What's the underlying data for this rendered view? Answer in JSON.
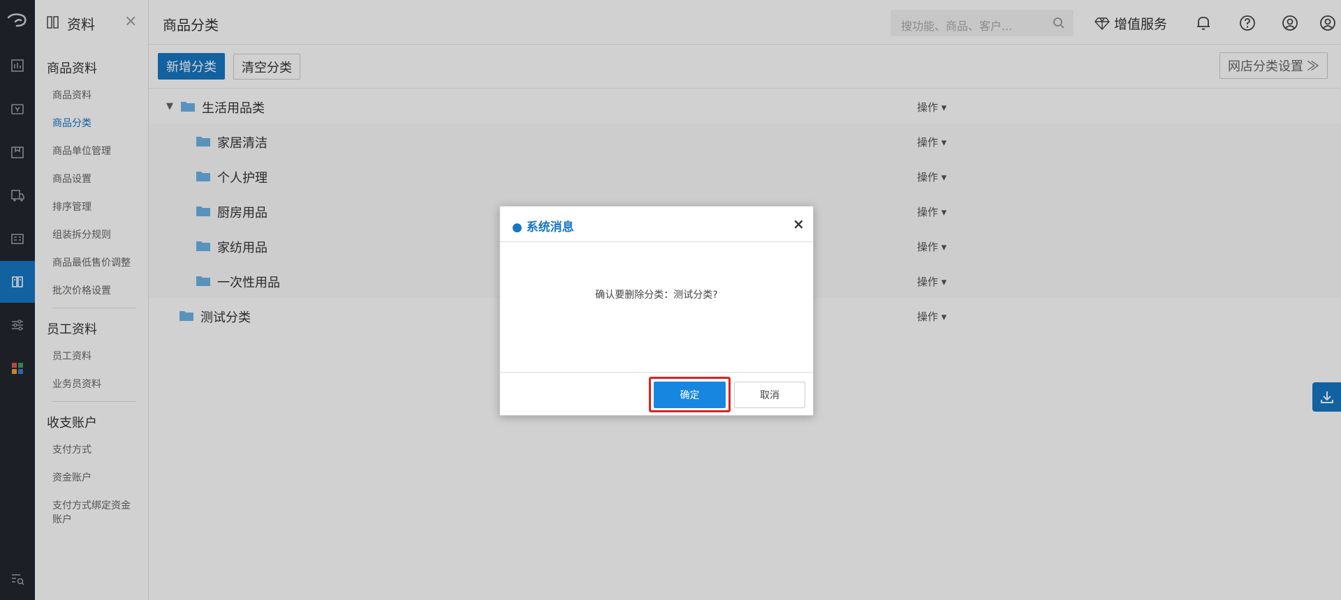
{
  "sidebar": {
    "title": "资料",
    "close": "×",
    "sections": [
      {
        "title": "商品资料",
        "items": [
          "商品资料",
          "商品分类",
          "商品单位管理",
          "商品设置",
          "排序管理",
          "组装拆分规则",
          "商品最低售价调整",
          "批次价格设置"
        ]
      },
      {
        "title": "员工资料",
        "items": [
          "员工资料",
          "业务员资料"
        ]
      },
      {
        "title": "收支账户",
        "items": [
          "支付方式",
          "资金账户",
          "支付方式绑定资金",
          "账户"
        ]
      }
    ],
    "active_item": "商品分类"
  },
  "header": {
    "page_title": "商品分类",
    "search_placeholder": "搜功能、商品、客户...",
    "value_added": "增值服务"
  },
  "toolbar": {
    "add_label": "新增分类",
    "clear_label": "清空分类",
    "shop_label": "网店分类设置 ≫"
  },
  "tree": {
    "op_label": "操作 ▾",
    "root": "生活用品类",
    "children": [
      "家居清洁",
      "个人护理",
      "厨房用品",
      "家纺用品",
      "一次性用品"
    ],
    "other": "测试分类"
  },
  "dialog": {
    "title": "● 系统消息",
    "close": "×",
    "message": "确认要删除分类：测试分类?",
    "ok": "确定",
    "cancel": "取消"
  },
  "colors": {
    "primary": "#1677c5",
    "rail": "#23272e",
    "highlight": "#e02020"
  }
}
